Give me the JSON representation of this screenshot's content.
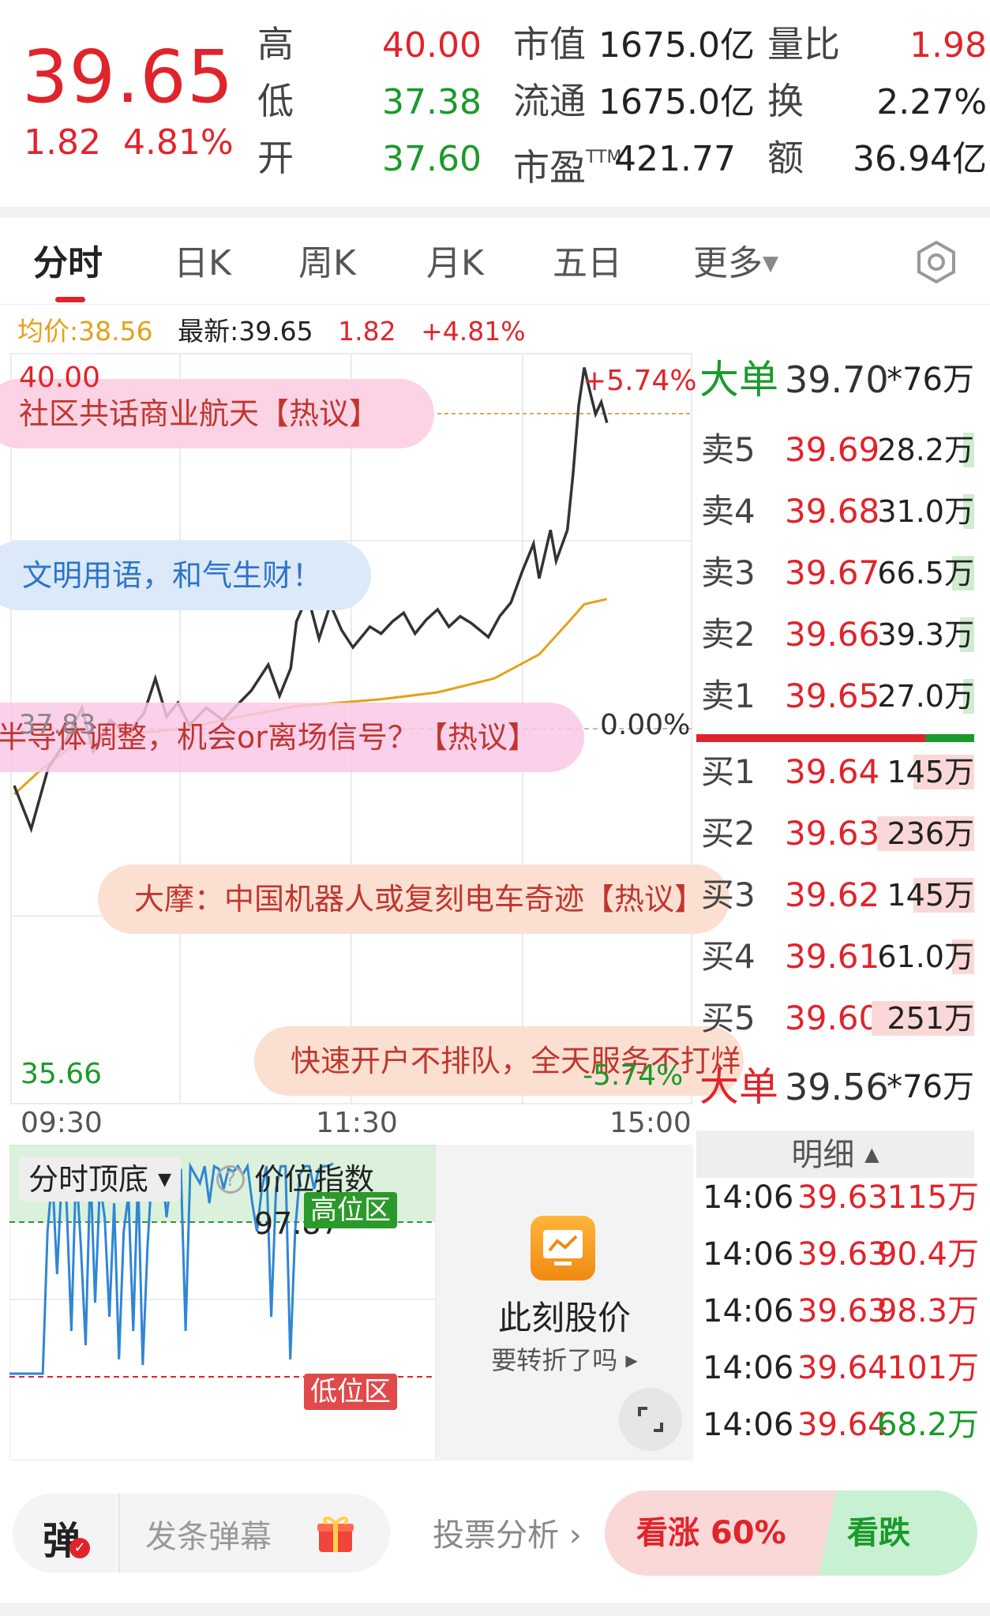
{
  "header": {
    "price": "39.65",
    "change": "1.82",
    "change_pct": "4.81%",
    "high_label": "高",
    "high": "40.00",
    "low_label": "低",
    "low": "37.38",
    "open_label": "开",
    "open": "37.60",
    "mcap_label": "市值",
    "mcap": "1675.0亿",
    "float_label": "流通",
    "float": "1675.0亿",
    "pe_label": "市盈",
    "pe_sup": "TTM",
    "pe": "421.77",
    "vr_label": "量比",
    "vr": "1.98",
    "turnover_label": "换",
    "turnover": "2.27%",
    "amount_label": "额",
    "amount": "36.94亿"
  },
  "tabs": [
    "分时",
    "日K",
    "周K",
    "月K",
    "五日",
    "更多"
  ],
  "info": {
    "avg": "均价:38.56",
    "latest": "最新:39.65",
    "chg": "1.82",
    "pct": "+4.81%"
  },
  "chart": {
    "top_price": "40.00",
    "bottom_price": "35.66",
    "top_pct": "+5.74%",
    "mid_pct": "0.00%",
    "bottom_pct": "-5.74%",
    "ref_price": "37.83",
    "time_start": "09:30",
    "time_mid": "11:30",
    "time_end": "15:00",
    "bubbles": [
      "社区共话商业航天【热议】",
      "文明用语，和气生财！",
      "半导体调整，机会or离场信号？【热议】",
      "大摩：中国机器人或复刻电车奇迹【热议】",
      "快速开户不排队，全天服务不打烊"
    ]
  },
  "orderbook": {
    "big_sell": {
      "label": "大单",
      "price": "39.70",
      "vol": "*76万"
    },
    "asks": [
      {
        "label": "卖5",
        "price": "39.69",
        "vol": "28.2万",
        "fill": 0.04
      },
      {
        "label": "卖4",
        "price": "39.68",
        "vol": "31.0万",
        "fill": 0.04
      },
      {
        "label": "卖3",
        "price": "39.67",
        "vol": "66.5万",
        "fill": 0.08
      },
      {
        "label": "卖2",
        "price": "39.66",
        "vol": "39.3万",
        "fill": 0.05
      },
      {
        "label": "卖1",
        "price": "39.65",
        "vol": "27.0万",
        "fill": 0.04
      }
    ],
    "bids": [
      {
        "label": "买1",
        "price": "39.64",
        "vol": "145万",
        "fill": 0.22
      },
      {
        "label": "买2",
        "price": "39.63",
        "vol": "236万",
        "fill": 0.35
      },
      {
        "label": "买3",
        "price": "39.62",
        "vol": "145万",
        "fill": 0.22
      },
      {
        "label": "买4",
        "price": "39.61",
        "vol": "61.0万",
        "fill": 0.08
      },
      {
        "label": "买5",
        "price": "39.60",
        "vol": "251万",
        "fill": 0.37
      }
    ],
    "big_buy": {
      "label": "大单",
      "price": "39.56",
      "vol": "*76万"
    },
    "detail_label": "明细",
    "details": [
      {
        "time": "14:06",
        "price": "39.63",
        "vol": "115万",
        "vol_color": "#e0242b"
      },
      {
        "time": "14:06",
        "price": "39.63",
        "vol": "90.4万",
        "vol_color": "#e0242b"
      },
      {
        "time": "14:06",
        "price": "39.63",
        "vol": "98.3万",
        "vol_color": "#e0242b"
      },
      {
        "time": "14:06",
        "price": "39.64",
        "vol": "101万",
        "vol_color": "#e0242b"
      },
      {
        "time": "14:06",
        "price": "39.64",
        "vol": "68.2万",
        "vol_color": "#1a9a2a"
      }
    ]
  },
  "indicator": {
    "name": "分时顶底",
    "index_text": "价位指数97.87",
    "high_zone": "高位区",
    "low_zone": "低位区"
  },
  "promo": {
    "title": "此刻股价",
    "subtitle": "要转折了吗"
  },
  "bottom": {
    "danmu_icon": "弹",
    "danmu_placeholder": "发条弹幕",
    "vote_label": "投票分析",
    "up_label": "看涨 60%",
    "down_label": "看跌 40%",
    "up_pct": 0.6
  },
  "colors": {
    "up": "#e0242b",
    "down": "#1a9a2a",
    "avg_line": "#e5a11a"
  }
}
